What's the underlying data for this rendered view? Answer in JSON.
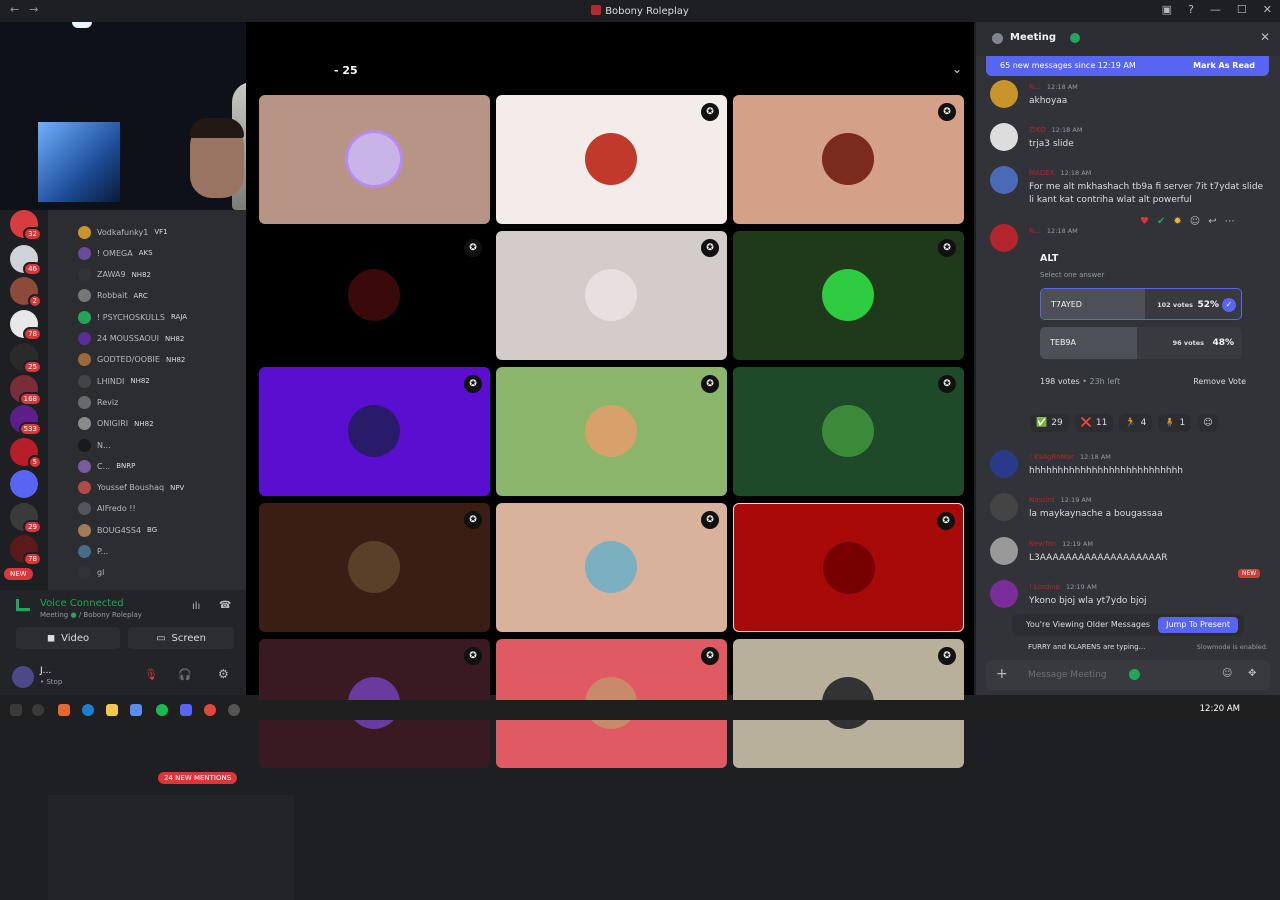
{
  "window": {
    "title": "Bobony Roleplay"
  },
  "servers": [
    {
      "badge": "32",
      "color": "#d83c3e"
    },
    {
      "badge": "46",
      "color": "#cfd3d8"
    },
    {
      "badge": "2",
      "color": "#8b4a3a"
    },
    {
      "badge": "78",
      "color": "#e8e8e8"
    },
    {
      "badge": "25",
      "color": "#2a2a2a"
    },
    {
      "badge": "168",
      "color": "#7a2d38"
    },
    {
      "badge": "533",
      "color": "#5b1e8a"
    },
    {
      "badge": "5",
      "color": "#b81d2a"
    },
    {
      "badge": "",
      "color": "#5865f2"
    },
    {
      "badge": "29",
      "color": "#3a3a3a"
    },
    {
      "badge": "78",
      "color": "#5a1a1a"
    }
  ],
  "rail_new": "NEW",
  "voice_users": [
    {
      "name": "Vodkafunky1",
      "tag": "VF1",
      "color": "#c9942b"
    },
    {
      "name": "! OMEGA",
      "tag": "AKS",
      "color": "#6a4b9a"
    },
    {
      "name": "ZAWA9",
      "tag": "NH82",
      "color": "#333"
    },
    {
      "name": "Robbait",
      "tag": "ARC",
      "color": "#777"
    },
    {
      "name": "! PSYCHOSKULLS",
      "tag": "RAJA",
      "color": "#23a55a"
    },
    {
      "name": "24 MOUSSAOUI",
      "tag": "NH82",
      "color": "#5b2d9a"
    },
    {
      "name": "GODTED/OOBIE",
      "tag": "NH82",
      "color": "#9a6a3a"
    },
    {
      "name": "LHINDI",
      "tag": "NH82",
      "color": "#444"
    },
    {
      "name": "Reviz",
      "tag": "",
      "color": "#6a6a6a"
    },
    {
      "name": "ONIGIRI",
      "tag": "NH82",
      "color": "#8a8a8a"
    },
    {
      "name": "N...",
      "tag": "",
      "color": "#1a1a1a"
    },
    {
      "name": "C...",
      "tag": "BNRP",
      "color": "#7a5aa0"
    },
    {
      "name": "Youssef Boushaq",
      "tag": "NPV",
      "color": "#b34a4a"
    },
    {
      "name": "AlFredo !!",
      "tag": "",
      "color": "#555"
    },
    {
      "name": "BOUG4SS4",
      "tag": "BG",
      "color": "#a07a5a"
    },
    {
      "name": "P...",
      "tag": "",
      "color": "#4a6a8a"
    },
    {
      "name": "gl",
      "tag": "",
      "color": "#333"
    }
  ],
  "mentions_pill": "24 NEW MENTIONS",
  "voice": {
    "status": "Voice Connected",
    "channel": "Meeting",
    "server": "/ Bobony Roleplay",
    "video_label": "Video",
    "screen_label": "Screen"
  },
  "user": {
    "name": "J...",
    "status": "• Stop"
  },
  "stage": {
    "title": "- 25"
  },
  "chat": {
    "title": "Meeting",
    "new_messages": "65 new messages since 12:19 AM",
    "mark_read": "Mark As Read",
    "messages": [
      {
        "name": "N...",
        "time": "12:18 AM",
        "text": "akhoyaa",
        "color": "#c9942b"
      },
      {
        "name": "ZIKO",
        "time": "12:18 AM",
        "text": "trja3 slide",
        "color": "#ddd"
      },
      {
        "name": "MADEX",
        "time": "12:18 AM",
        "text": "For me alt mkhashach tb9a fi server 7it t7ydat slide li kant kat contriha wlat alt powerful",
        "color": "#4b6ab8"
      },
      {
        "name": "N...",
        "time": "12:18 AM",
        "text": "",
        "color": "#b3242e"
      },
      {
        "name": "! KsAgRnMar",
        "time": "12:18 AM",
        "text": "hhhhhhhhhhhhhhhhhhhhhhhhhhh",
        "color": "#2a3a8a"
      },
      {
        "name": "Nassim",
        "time": "12:19 AM",
        "text": "la maykaynache a bougassaa",
        "color": "#444"
      },
      {
        "name": "NewTon",
        "time": "12:19 AM",
        "text": "L3AAAAAAAAAAAAAAAAAAAR",
        "color": "#999"
      },
      {
        "name": "! Lordino",
        "time": "12:19 AM",
        "text": "Ykono bjoj wla yt7ydo bjoj",
        "color": "#7a2d9a"
      }
    ],
    "poll": {
      "question": "ALT",
      "subtitle": "Select one answer",
      "options": [
        {
          "label": "T7AYED",
          "votes": "102 votes",
          "pct": "52%",
          "fraction": 0.52,
          "selected": true
        },
        {
          "label": "TEB9A",
          "votes": "96 votes",
          "pct": "48%",
          "fraction": 0.48,
          "selected": false
        }
      ],
      "total": "198 votes",
      "time_left": "23h left",
      "remove_vote": "Remove Vote"
    },
    "reactions": [
      {
        "emoji": "✅",
        "count": "29"
      },
      {
        "emoji": "❌",
        "count": "11"
      },
      {
        "emoji": "🏃",
        "count": "4"
      },
      {
        "emoji": "🧍",
        "count": "1"
      }
    ],
    "new_tag": "NEW",
    "older_notice": "You're Viewing Older Messages",
    "jump_label": "Jump To Present",
    "typing": "FURRY and KLARENS are typing...",
    "slowmode": "Slowmode is enabled.",
    "composer_placeholder": "Message Meeting"
  },
  "taskbar": {
    "time": "12:20 AM"
  }
}
